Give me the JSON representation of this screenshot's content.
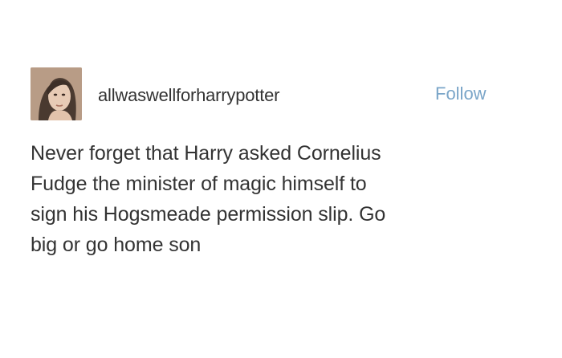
{
  "post": {
    "author": {
      "username": "allwaswellforharrypotter",
      "avatar_icon": "profile-photo"
    },
    "follow_label": "Follow",
    "text_lines": [
      "Never forget that Harry asked Cornelius",
      "Fudge the minister of magic himself to",
      "sign his Hogsmeade permission slip. Go",
      "big or go home son"
    ]
  },
  "colors": {
    "background": "#ffffff",
    "text": "#333333",
    "follow": "#7aa5c8"
  }
}
